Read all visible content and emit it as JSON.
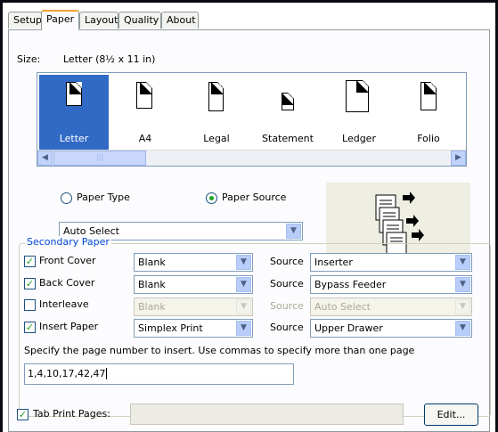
{
  "tabs": [
    {
      "label": "Setup",
      "active": false
    },
    {
      "label": "Paper",
      "active": true
    },
    {
      "label": "Layout",
      "active": false
    },
    {
      "label": "Quality",
      "active": false
    },
    {
      "label": "About",
      "active": false
    }
  ],
  "size": {
    "label": "Size:",
    "value": "Letter (8½ x 11 in)",
    "selected": "Letter",
    "items": [
      "Letter",
      "A4",
      "Legal",
      "Statement",
      "Ledger",
      "Folio"
    ]
  },
  "paper_choice": {
    "type_label": "Paper Type",
    "source_label": "Paper Source",
    "selected": "Paper Source",
    "combo_value": "Auto Select"
  },
  "secondary": {
    "title": "Secondary Paper",
    "source_label": "Source",
    "rows": [
      {
        "label": "Front Cover",
        "checked": true,
        "enabled": true,
        "paper": "Blank",
        "source": "Inserter"
      },
      {
        "label": "Back Cover",
        "checked": true,
        "enabled": true,
        "paper": "Blank",
        "source": "Bypass Feeder"
      },
      {
        "label": "Interleave",
        "checked": false,
        "enabled": false,
        "paper": "Blank",
        "source": "Auto Select"
      },
      {
        "label": "Insert Paper",
        "checked": true,
        "enabled": true,
        "paper": "Simplex Print",
        "source": "Upper Drawer"
      }
    ],
    "instruction": "Specify the page number to insert. Use commas to specify more than one page",
    "pages_value": "1,4,10,17,42,47"
  },
  "tab_print": {
    "label": "Tab Print Pages:",
    "checked": true,
    "value": "",
    "edit_button": "Edit..."
  },
  "colors": {
    "selection": "#316ac5",
    "group_title": "#0046d5",
    "check": "#21a121"
  }
}
